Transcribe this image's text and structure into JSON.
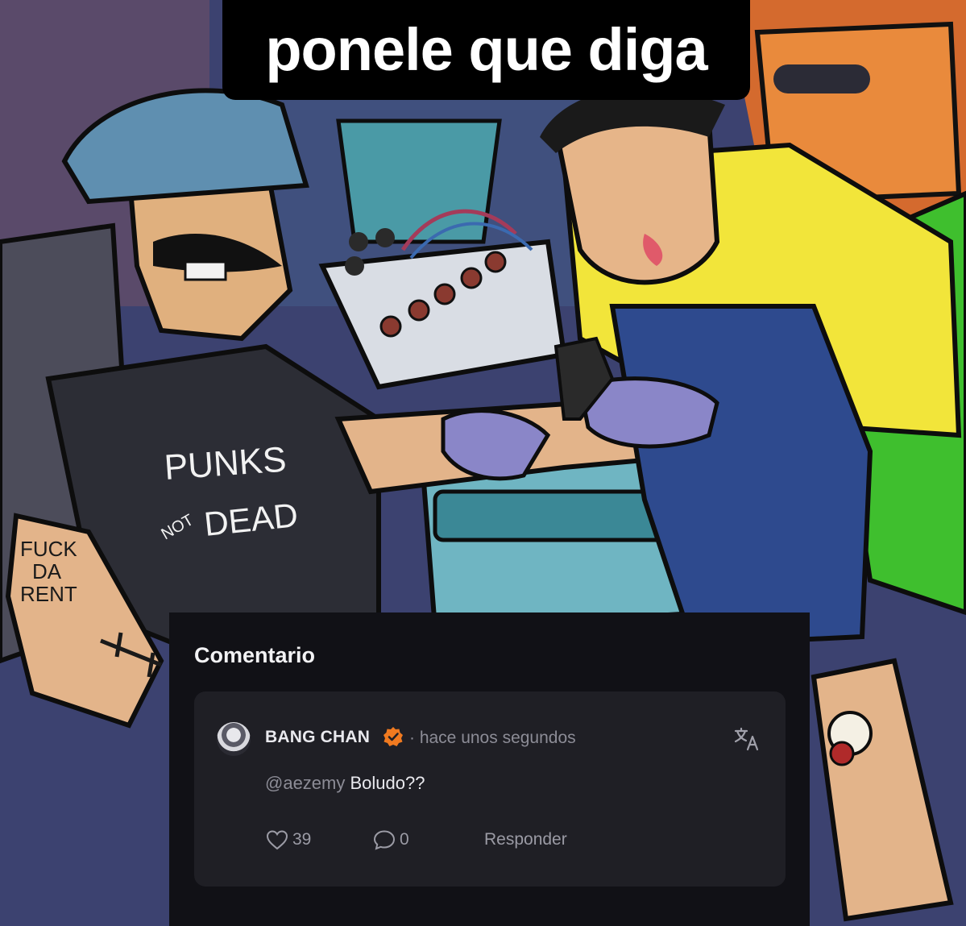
{
  "meme": {
    "caption": "ponele que diga",
    "shirt_text_line1": "PUNKS",
    "shirt_text_small": "NOT",
    "shirt_text_line2": "DEAD",
    "arm_tattoo_line1": "FUCK",
    "arm_tattoo_line2": "DA",
    "arm_tattoo_line3": "RENT"
  },
  "comment_panel": {
    "title": "Comentario",
    "comment": {
      "username": "BANG CHAN",
      "timestamp": "· hace unos segundos",
      "mention": "@aezemy",
      "text": "Boludo??",
      "likes": "39",
      "replies": "0",
      "reply_label": "Responder"
    }
  },
  "icons": {
    "verified": "verified-badge-icon",
    "translate": "translate-icon",
    "like": "heart-icon",
    "replies": "chat-bubble-icon"
  },
  "colors": {
    "panel_bg": "#111116",
    "card_bg": "#1f1f25",
    "verified_badge": "#f07a20",
    "caption_bg": "#000000"
  }
}
